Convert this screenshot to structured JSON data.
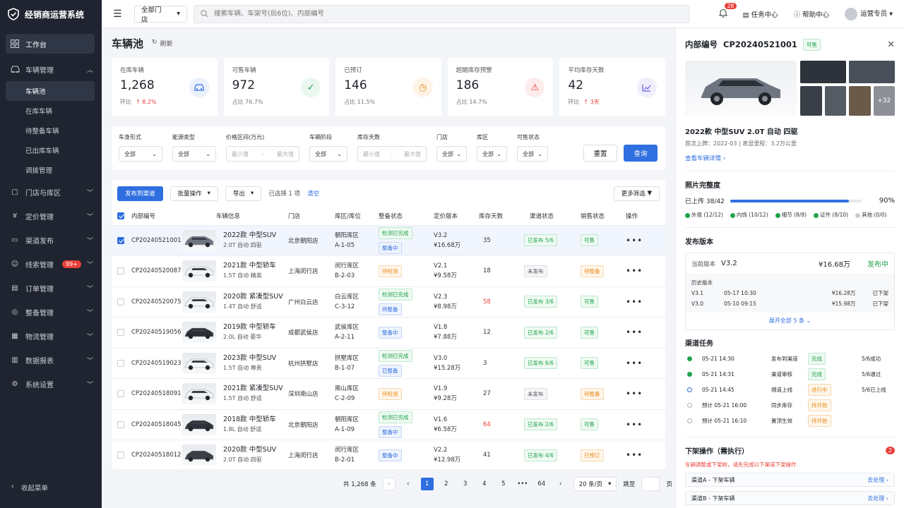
{
  "app": {
    "name": "经销商运营系统"
  },
  "sidebar": {
    "workbench": "工作台",
    "vehicle_mgmt": "车辆管理",
    "vehicle_subs": [
      "车辆池",
      "在库车辆",
      "待整备车辆",
      "已出库车辆",
      "调拨管理"
    ],
    "groups": [
      {
        "label": "门店与库区"
      },
      {
        "label": "定价管理"
      },
      {
        "label": "渠道发布"
      },
      {
        "label": "线索管理",
        "badge": "99+"
      },
      {
        "label": "订单管理"
      },
      {
        "label": "整备管理"
      },
      {
        "label": "物流管理"
      },
      {
        "label": "数据报表"
      },
      {
        "label": "系统设置"
      }
    ],
    "collapse": "收起菜单"
  },
  "topbar": {
    "store": "全部门店",
    "search_placeholder": "搜索车辆、车架号(后6位)、内部编号",
    "notif_count": "28",
    "task_center": "任务中心",
    "help_center": "帮助中心",
    "user": "运营专员"
  },
  "page": {
    "title": "车辆池",
    "refresh": "刷新"
  },
  "stats": [
    {
      "label": "在库车辆",
      "value": "1,268",
      "sub_label": "环比",
      "sub_value": "↑ 8.2%",
      "up": true
    },
    {
      "label": "可售车辆",
      "value": "972",
      "sub_label": "占比",
      "sub_value": "76.7%",
      "up": false
    },
    {
      "label": "已预订",
      "value": "146",
      "sub_label": "占比",
      "sub_value": "11.5%",
      "up": false
    },
    {
      "label": "超期库存预警",
      "value": "186",
      "sub_label": "占比",
      "sub_value": "14.7%",
      "up": false
    },
    {
      "label": "平均库存天数",
      "value": "42",
      "sub_label": "环比",
      "sub_value": "↑ 3天",
      "up": true
    }
  ],
  "filters": {
    "body": {
      "label": "车身形式",
      "value": "全部"
    },
    "energy": {
      "label": "能源类型",
      "value": "全部"
    },
    "price": {
      "label": "价格区间(万元)",
      "min": "最小值",
      "sep": "-",
      "max": "最大值"
    },
    "stage": {
      "label": "车辆阶段",
      "value": "全部"
    },
    "days": {
      "label": "库存天数",
      "min": "最小值",
      "sep": "-",
      "max": "最大值"
    },
    "store": {
      "label": "门店",
      "value": "全部"
    },
    "zone": {
      "label": "库区",
      "value": "全部"
    },
    "sale": {
      "label": "可售状态",
      "value": "全部"
    },
    "reset": "重置",
    "query": "查询"
  },
  "toolbar": {
    "publish": "发布到渠道",
    "batch": "批量操作",
    "export": "导出",
    "selected": "已选择 1 项",
    "clear": "清空",
    "more_filter": "更多筛选"
  },
  "table": {
    "headers": [
      "内部编号",
      "车辆信息",
      "门店",
      "库区/库位",
      "整备状态",
      "定价版本",
      "库存天数",
      "渠道状态",
      "销售状态",
      "操作"
    ],
    "rows": [
      {
        "id": "CP20240521001",
        "title": "2022款 中型SUV",
        "spec": "2.0T  自动  四驱",
        "store": "北京朝阳店",
        "zone": "朝阳库区",
        "slot": "A-1-05",
        "prep": [
          {
            "t": "检测已完成",
            "c": "green"
          },
          {
            "t": "整备中",
            "c": "blue"
          }
        ],
        "ver": "V3.2",
        "price": "¥16.68万",
        "days": "35",
        "days_red": false,
        "channel": {
          "t": "已发布 5/6",
          "c": "green"
        },
        "sale": {
          "t": "可售",
          "c": "green"
        },
        "checked": true
      },
      {
        "id": "CP20240520087",
        "title": "2021款 中型轿车",
        "spec": "1.5T  自动  精英",
        "store": "上海闵行店",
        "zone": "闵行库区",
        "slot": "B-2-03",
        "prep": [
          {
            "t": "待检测",
            "c": "orange"
          }
        ],
        "ver": "V2.1",
        "price": "¥9.58万",
        "days": "18",
        "days_red": false,
        "channel": {
          "t": "未发布",
          "c": "gray"
        },
        "sale": {
          "t": "待整备",
          "c": "orange"
        },
        "checked": false
      },
      {
        "id": "CP20240520075",
        "title": "2020款 紧凑型SUV",
        "spec": "1.4T  自动  舒适",
        "store": "广州白云店",
        "zone": "白云库区",
        "slot": "C-3-12",
        "prep": [
          {
            "t": "检测已完成",
            "c": "green"
          },
          {
            "t": "待整备",
            "c": "blue"
          }
        ],
        "ver": "V2.3",
        "price": "¥8.98万",
        "days": "58",
        "days_red": true,
        "channel": {
          "t": "已发布 3/6",
          "c": "green"
        },
        "sale": {
          "t": "可售",
          "c": "green"
        },
        "checked": false
      },
      {
        "id": "CP20240519056",
        "title": "2019款 中型轿车",
        "spec": "2.0L  自动  豪华",
        "store": "成都武侯店",
        "zone": "武侯库区",
        "slot": "A-2-11",
        "prep": [
          {
            "t": "整备中",
            "c": "blue"
          }
        ],
        "ver": "V1.8",
        "price": "¥7.88万",
        "days": "12",
        "days_red": false,
        "channel": {
          "t": "已发布 2/6",
          "c": "green"
        },
        "sale": {
          "t": "可售",
          "c": "green"
        },
        "checked": false
      },
      {
        "id": "CP20240519023",
        "title": "2023款 中型SUV",
        "spec": "1.5T  自动  尊贵",
        "store": "杭州拱墅店",
        "zone": "拱墅库区",
        "slot": "B-1-07",
        "prep": [
          {
            "t": "检测已完成",
            "c": "green"
          },
          {
            "t": "已整备",
            "c": "blue"
          }
        ],
        "ver": "V3.0",
        "price": "¥15.28万",
        "days": "3",
        "days_red": false,
        "channel": {
          "t": "已发布 6/6",
          "c": "green"
        },
        "sale": {
          "t": "可售",
          "c": "green"
        },
        "checked": false
      },
      {
        "id": "CP20240518091",
        "title": "2021款 紧凑型SUV",
        "spec": "1.5T  自动  舒适",
        "store": "深圳南山店",
        "zone": "南山库区",
        "slot": "C-2-09",
        "prep": [
          {
            "t": "待检测",
            "c": "orange"
          }
        ],
        "ver": "V1.9",
        "price": "¥9.28万",
        "days": "27",
        "days_red": false,
        "channel": {
          "t": "未发布",
          "c": "gray"
        },
        "sale": {
          "t": "待整备",
          "c": "orange"
        },
        "checked": false
      },
      {
        "id": "CP20240518045",
        "title": "2018款 中型轿车",
        "spec": "1.8L  自动  舒适",
        "store": "北京朝阳店",
        "zone": "朝阳库区",
        "slot": "A-1-09",
        "prep": [
          {
            "t": "检测已完成",
            "c": "green"
          },
          {
            "t": "整备中",
            "c": "blue"
          }
        ],
        "ver": "V1.6",
        "price": "¥6.58万",
        "days": "64",
        "days_red": true,
        "channel": {
          "t": "已发布 2/6",
          "c": "green"
        },
        "sale": {
          "t": "可售",
          "c": "green"
        },
        "checked": false
      },
      {
        "id": "CP20240518012",
        "title": "2020款 中型SUV",
        "spec": "2.0T  自动  四驱",
        "store": "上海闵行店",
        "zone": "闵行库区",
        "slot": "B-2-01",
        "prep": [
          {
            "t": "整备中",
            "c": "blue"
          }
        ],
        "ver": "V2.2",
        "price": "¥12.98万",
        "days": "41",
        "days_red": false,
        "channel": {
          "t": "已发布 4/6",
          "c": "green"
        },
        "sale": {
          "t": "已预订",
          "c": "orange"
        },
        "checked": false
      }
    ]
  },
  "pagination": {
    "total": "共 1,268 条",
    "pages": [
      "1",
      "2",
      "3",
      "4",
      "5"
    ],
    "ellipsis": "•••",
    "last": "64",
    "size": "20 条/页",
    "jump_label": "跳至",
    "page_unit": "页"
  },
  "detail": {
    "id_label": "内部编号",
    "id": "CP20240521001",
    "status": "可售",
    "more_photos": "+32",
    "title": "2022款 中型SUV 2.0T 自动 四驱",
    "meta": "首次上牌：2022-03 | 表显里程：3.2万公里",
    "view_detail": "查看车辆详情 ›",
    "photo": {
      "title": "照片完整度",
      "uploaded": "已上传 38/42",
      "percent": "90%",
      "progress": 0.9,
      "cats": [
        {
          "t": "外观 (12/12)",
          "done": true
        },
        {
          "t": "内饰 (10/12)",
          "done": true
        },
        {
          "t": "细节 (8/8)",
          "done": true
        },
        {
          "t": "证件 (8/10)",
          "done": true
        },
        {
          "t": "其他 (0/0)",
          "done": false
        }
      ]
    },
    "version": {
      "title": "发布版本",
      "cur_label": "当前版本",
      "cur": "V3.2",
      "price": "¥16.68万",
      "state": "发布中",
      "hist_label": "历史版本",
      "history": [
        {
          "v": "V3.1",
          "time": "05-17 10:30",
          "price": "¥16.28万",
          "state": "已下架"
        },
        {
          "v": "V3.0",
          "time": "05-10 09:15",
          "price": "¥15.98万",
          "state": "已下架"
        }
      ],
      "expand": "展开全部 5 条 ⌄"
    },
    "tasks": {
      "title": "渠道任务",
      "items": [
        {
          "time": "05-21 14:30",
          "name": "发布到渠道",
          "status": "完成",
          "c": "green",
          "dot": "done",
          "result": "5/6成功"
        },
        {
          "time": "05-21 14:31",
          "name": "渠道审核",
          "status": "完成",
          "c": "green",
          "dot": "done",
          "result": "5/6通过"
        },
        {
          "time": "05-21 14:45",
          "name": "频道上线",
          "status": "进行中",
          "c": "orange",
          "dot": "ring",
          "result": "5/6已上线"
        },
        {
          "time": "预计  05-21 16:00",
          "name": "同步库存",
          "status": "待开始",
          "c": "orange",
          "dot": "gray",
          "result": ""
        },
        {
          "time": "预计  05-21 16:10",
          "name": "置顶生效",
          "status": "待开始",
          "c": "orange",
          "dot": "gray",
          "result": ""
        }
      ]
    },
    "offline": {
      "title": "下架操作（需执行）",
      "count": "2",
      "warn": "车辆调整或下架前，请先完成以下渠道下架操作",
      "items": [
        {
          "t": "渠道A - 下架车辆",
          "go": "去处理 ›"
        },
        {
          "t": "渠道B - 下架车辆",
          "go": "去处理 ›"
        }
      ]
    }
  },
  "colors": {
    "primary": "#2f6fe0",
    "sidebar_bg": "#1f2430",
    "success": "#20a34a",
    "warning": "#e88a1a",
    "danger": "#e8403a"
  }
}
